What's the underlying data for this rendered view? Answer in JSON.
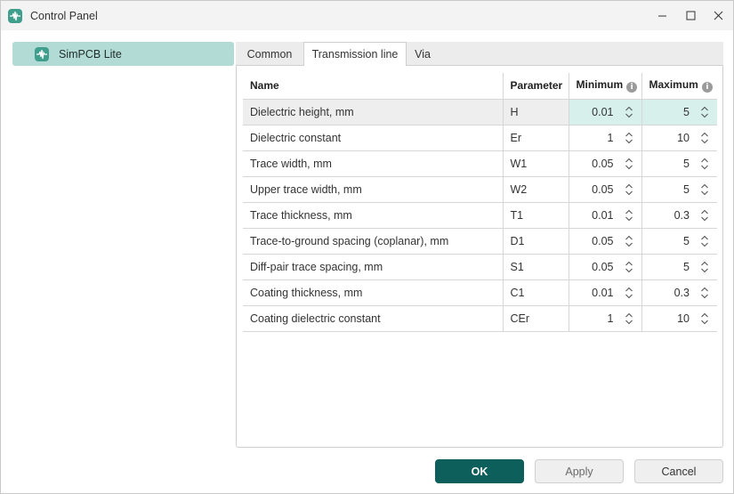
{
  "window": {
    "title": "Control Panel"
  },
  "sidebar": {
    "items": [
      {
        "label": "SimPCB Lite",
        "icon": "waveform-icon"
      }
    ]
  },
  "tabs": [
    "Common",
    "Transmission line",
    "Via"
  ],
  "active_tab": "Transmission line",
  "table": {
    "headers": {
      "name": "Name",
      "parameter": "Parameter",
      "minimum": "Minimum",
      "maximum": "Maximum",
      "info": "i"
    },
    "rows": [
      {
        "name": "Dielectric height, mm",
        "param": "H",
        "min": "0.01",
        "max": "5"
      },
      {
        "name": "Dielectric constant",
        "param": "Er",
        "min": "1",
        "max": "10"
      },
      {
        "name": "Trace width, mm",
        "param": "W1",
        "min": "0.05",
        "max": "5"
      },
      {
        "name": "Upper trace width, mm",
        "param": "W2",
        "min": "0.05",
        "max": "5"
      },
      {
        "name": "Trace thickness, mm",
        "param": "T1",
        "min": "0.01",
        "max": "0.3"
      },
      {
        "name": "Trace-to-ground spacing (coplanar), mm",
        "param": "D1",
        "min": "0.05",
        "max": "5"
      },
      {
        "name": "Diff-pair trace spacing, mm",
        "param": "S1",
        "min": "0.05",
        "max": "5"
      },
      {
        "name": "Coating thickness, mm",
        "param": "C1",
        "min": "0.01",
        "max": "0.3"
      },
      {
        "name": "Coating dielectric constant",
        "param": "CEr",
        "min": "1",
        "max": "10"
      }
    ],
    "selected_row": 0
  },
  "buttons": {
    "ok": "OK",
    "apply": "Apply",
    "cancel": "Cancel"
  },
  "colors": {
    "accent": "#0d5f5b",
    "selection": "#b3dbd6",
    "logo": "#3f9e8c"
  }
}
